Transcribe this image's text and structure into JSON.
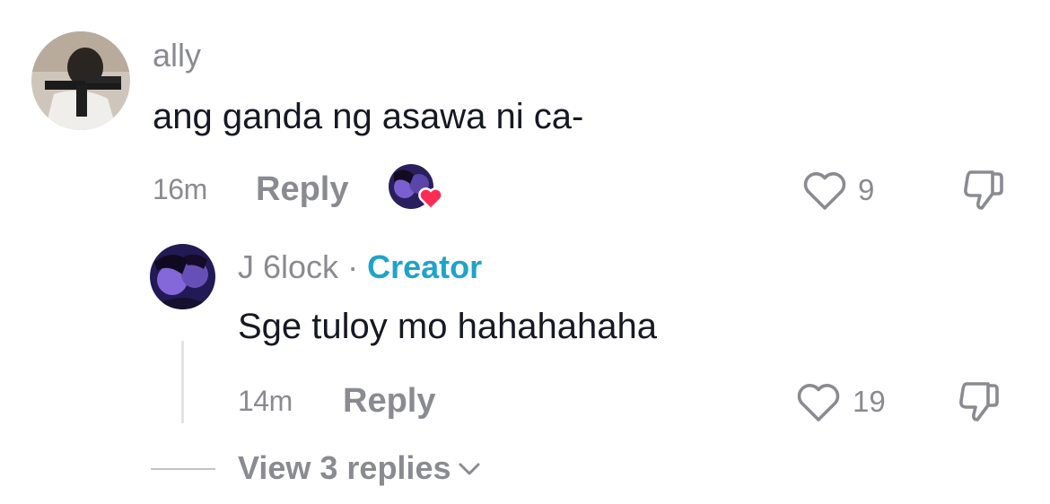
{
  "comment": {
    "username": "ally",
    "text": "ang ganda ng asawa ni ca-",
    "time": "16m",
    "reply_label": "Reply",
    "likes": "9"
  },
  "reply": {
    "username": "J 6lock",
    "separator": "·",
    "badge": "Creator",
    "text": "Sge tuloy mo hahahahaha",
    "time": "14m",
    "reply_label": "Reply",
    "likes": "19"
  },
  "view_replies_label": "View 3 replies",
  "icons": {
    "like": "heart-outline-icon",
    "dislike": "thumbs-down-icon",
    "creator_liked": "heart-badge-icon",
    "expand": "chevron-down-icon"
  },
  "colors": {
    "creator_badge": "#20a3c9",
    "liked_heart": "#fe2c55",
    "secondary_text": "#8a8b91"
  }
}
